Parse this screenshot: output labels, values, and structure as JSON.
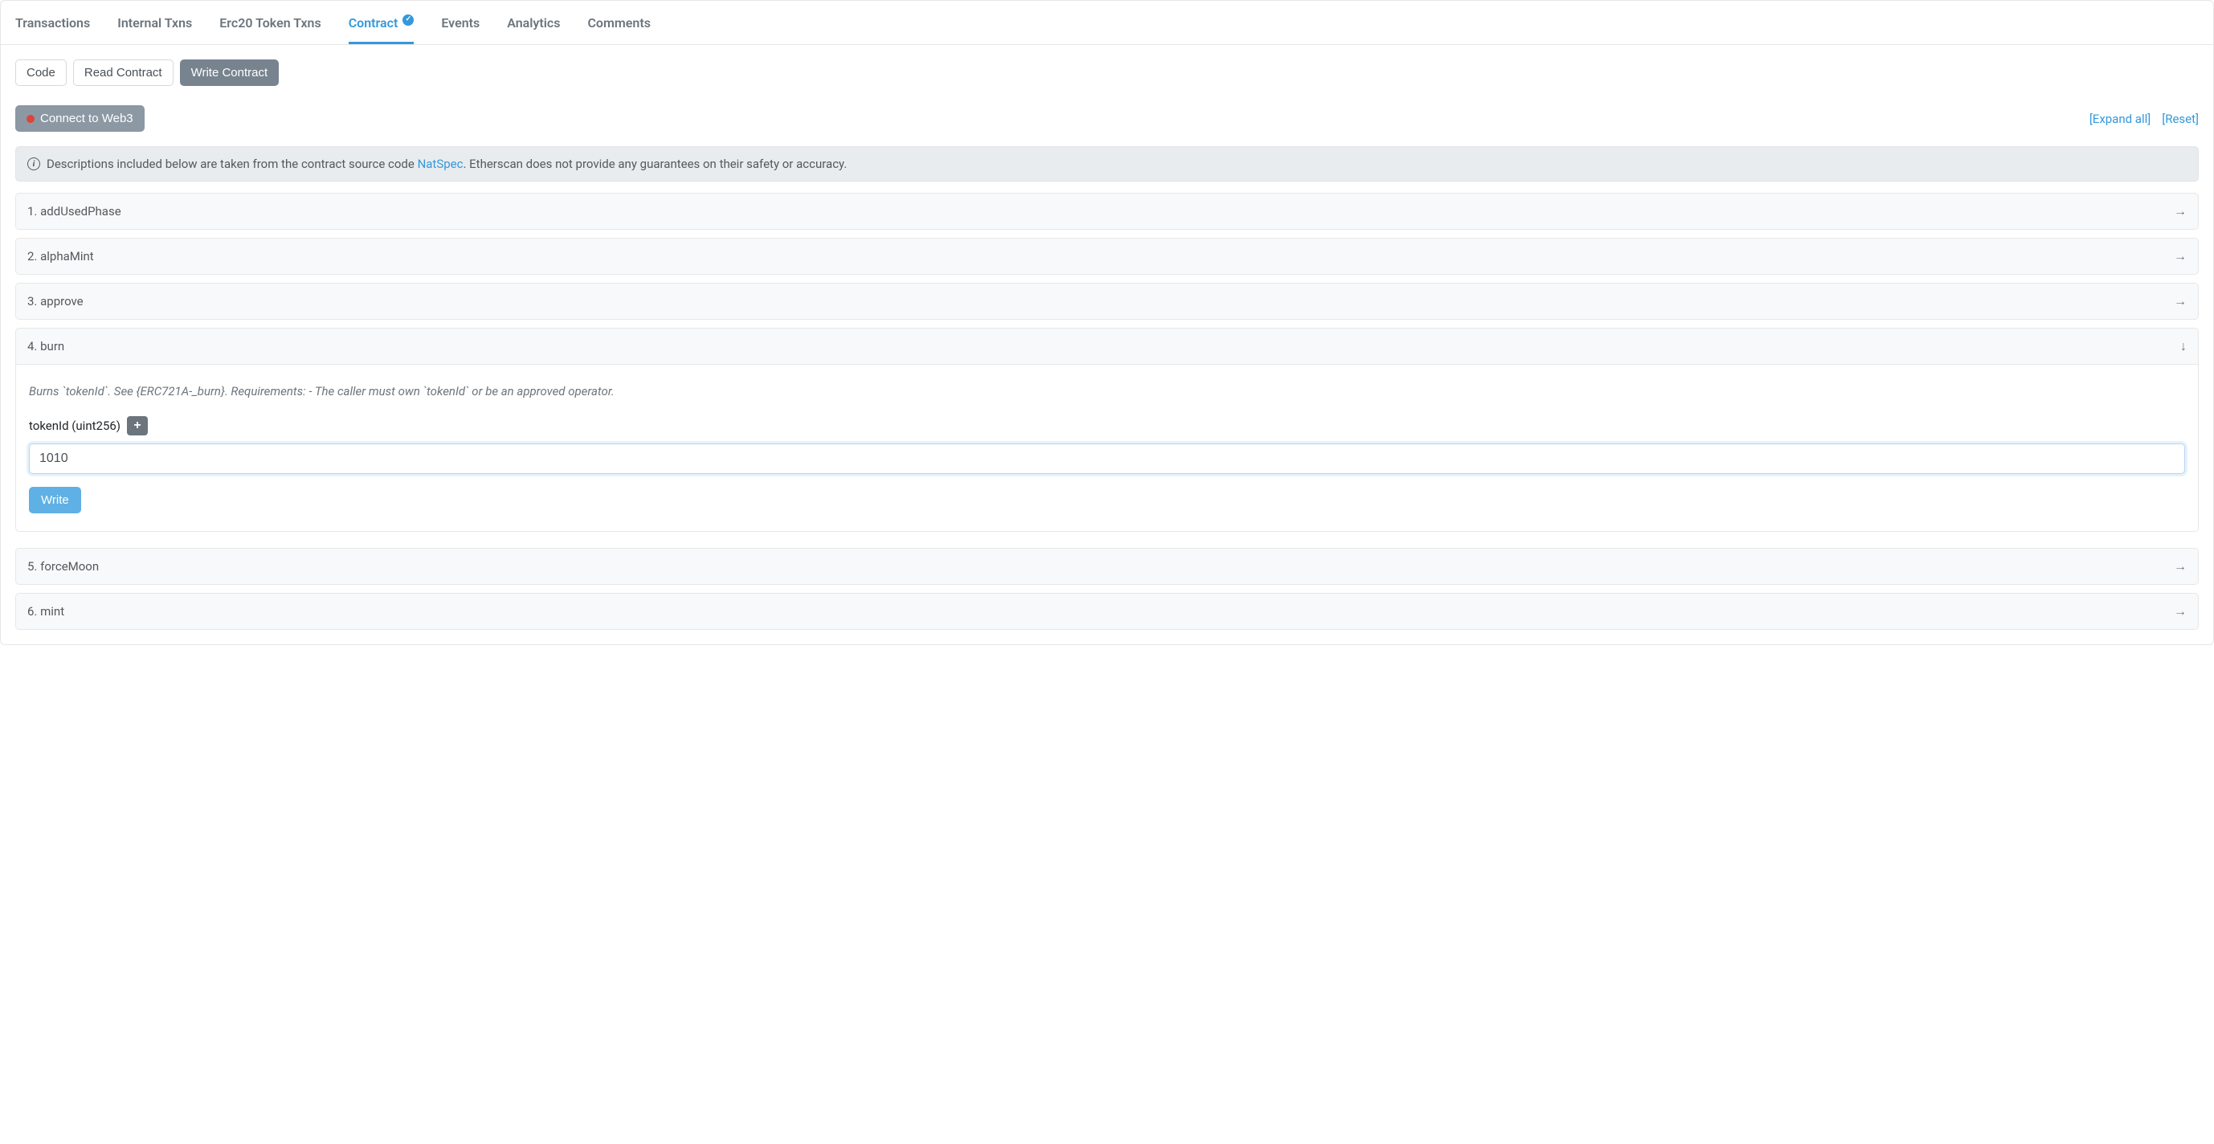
{
  "tabs": [
    {
      "label": "Transactions"
    },
    {
      "label": "Internal Txns"
    },
    {
      "label": "Erc20 Token Txns"
    },
    {
      "label": "Contract",
      "active": true,
      "verified": true
    },
    {
      "label": "Events"
    },
    {
      "label": "Analytics"
    },
    {
      "label": "Comments"
    }
  ],
  "subtabs": {
    "code": "Code",
    "read": "Read Contract",
    "write": "Write Contract"
  },
  "connect_label": "Connect to Web3",
  "expand_label": "[Expand all]",
  "reset_label": "[Reset]",
  "info": {
    "pre": "Descriptions included below are taken from the contract source code ",
    "link": "NatSpec",
    "post": ". Etherscan does not provide any guarantees on their safety or accuracy."
  },
  "functions": [
    {
      "idx": "1.",
      "name": "addUsedPhase"
    },
    {
      "idx": "2.",
      "name": "alphaMint"
    },
    {
      "idx": "3.",
      "name": "approve"
    },
    {
      "idx": "4.",
      "name": "burn",
      "expanded": true,
      "desc": "Burns `tokenId`. See {ERC721A-_burn}. Requirements: - The caller must own `tokenId` or be an approved operator.",
      "param_label": "tokenId (uint256)",
      "param_value": "1010",
      "write_label": "Write"
    },
    {
      "idx": "5.",
      "name": "forceMoon"
    },
    {
      "idx": "6.",
      "name": "mint"
    }
  ]
}
